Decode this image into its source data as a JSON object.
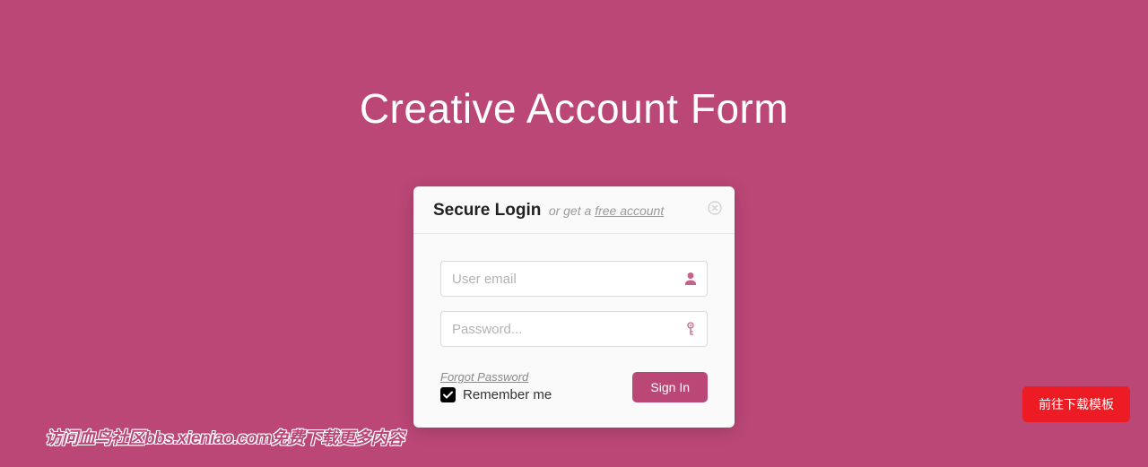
{
  "page": {
    "title": "Creative Account Form"
  },
  "card": {
    "title": "Secure Login",
    "subtitle_prefix": "or get a ",
    "free_account_label": "free account"
  },
  "form": {
    "email": {
      "placeholder": "User email",
      "value": ""
    },
    "password": {
      "placeholder": "Password...",
      "value": ""
    },
    "forgot_label": "Forgot Password",
    "remember_label": "Remember me",
    "remember_checked": true,
    "signin_label": "Sign In"
  },
  "floating": {
    "download_label": "前往下载模板"
  },
  "watermark": {
    "text": "访问血鸟社区bbs.xieniao.com免费下载更多内容"
  },
  "colors": {
    "brand": "#bb4777",
    "danger": "#ed1c24"
  }
}
